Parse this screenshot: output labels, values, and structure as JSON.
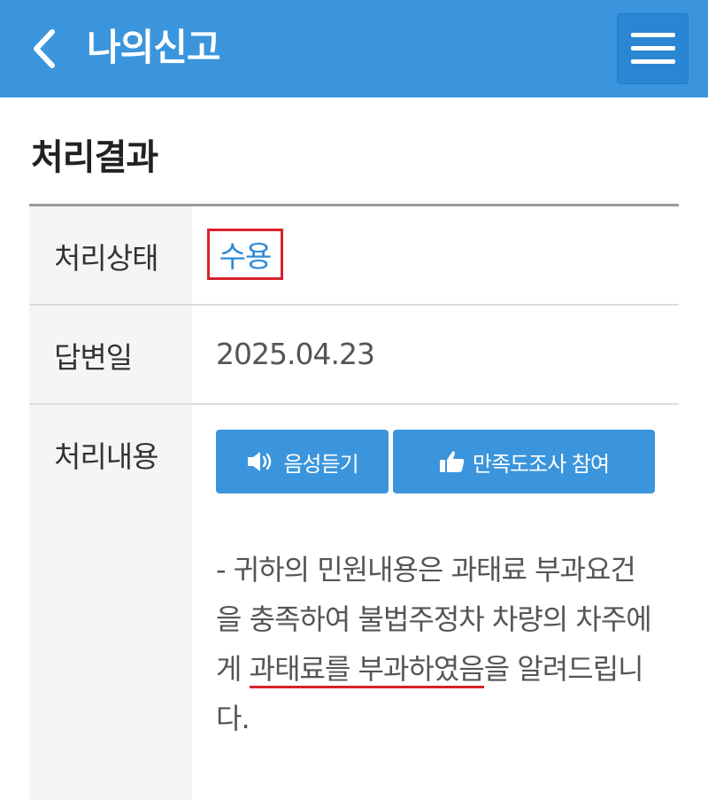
{
  "header": {
    "title": "나의신고",
    "back_icon": "chevron-left-icon",
    "menu_icon": "hamburger-menu-icon",
    "color": "#3a95dd"
  },
  "section": {
    "title": "처리결과"
  },
  "result": {
    "status_label": "처리상태",
    "status_value": "수용",
    "date_label": "답변일",
    "date_value": "2025.04.23",
    "content_label": "처리내용",
    "voice_button": "음성듣기",
    "voice_icon": "speaker-icon",
    "survey_button": "만족도조사 참여",
    "survey_icon": "thumbs-up-icon",
    "content_pre": "- 귀하의 민원내용은 과태료 부과요건을 충족하여 불법주정차 차량의 차주에게 ",
    "content_highlight": "과태료를 부과하였음",
    "content_post": "을 알려드립니다."
  },
  "colors": {
    "accent": "#3a95dd",
    "status_text": "#2d8ad6",
    "annotation_red": "#d7222b"
  }
}
